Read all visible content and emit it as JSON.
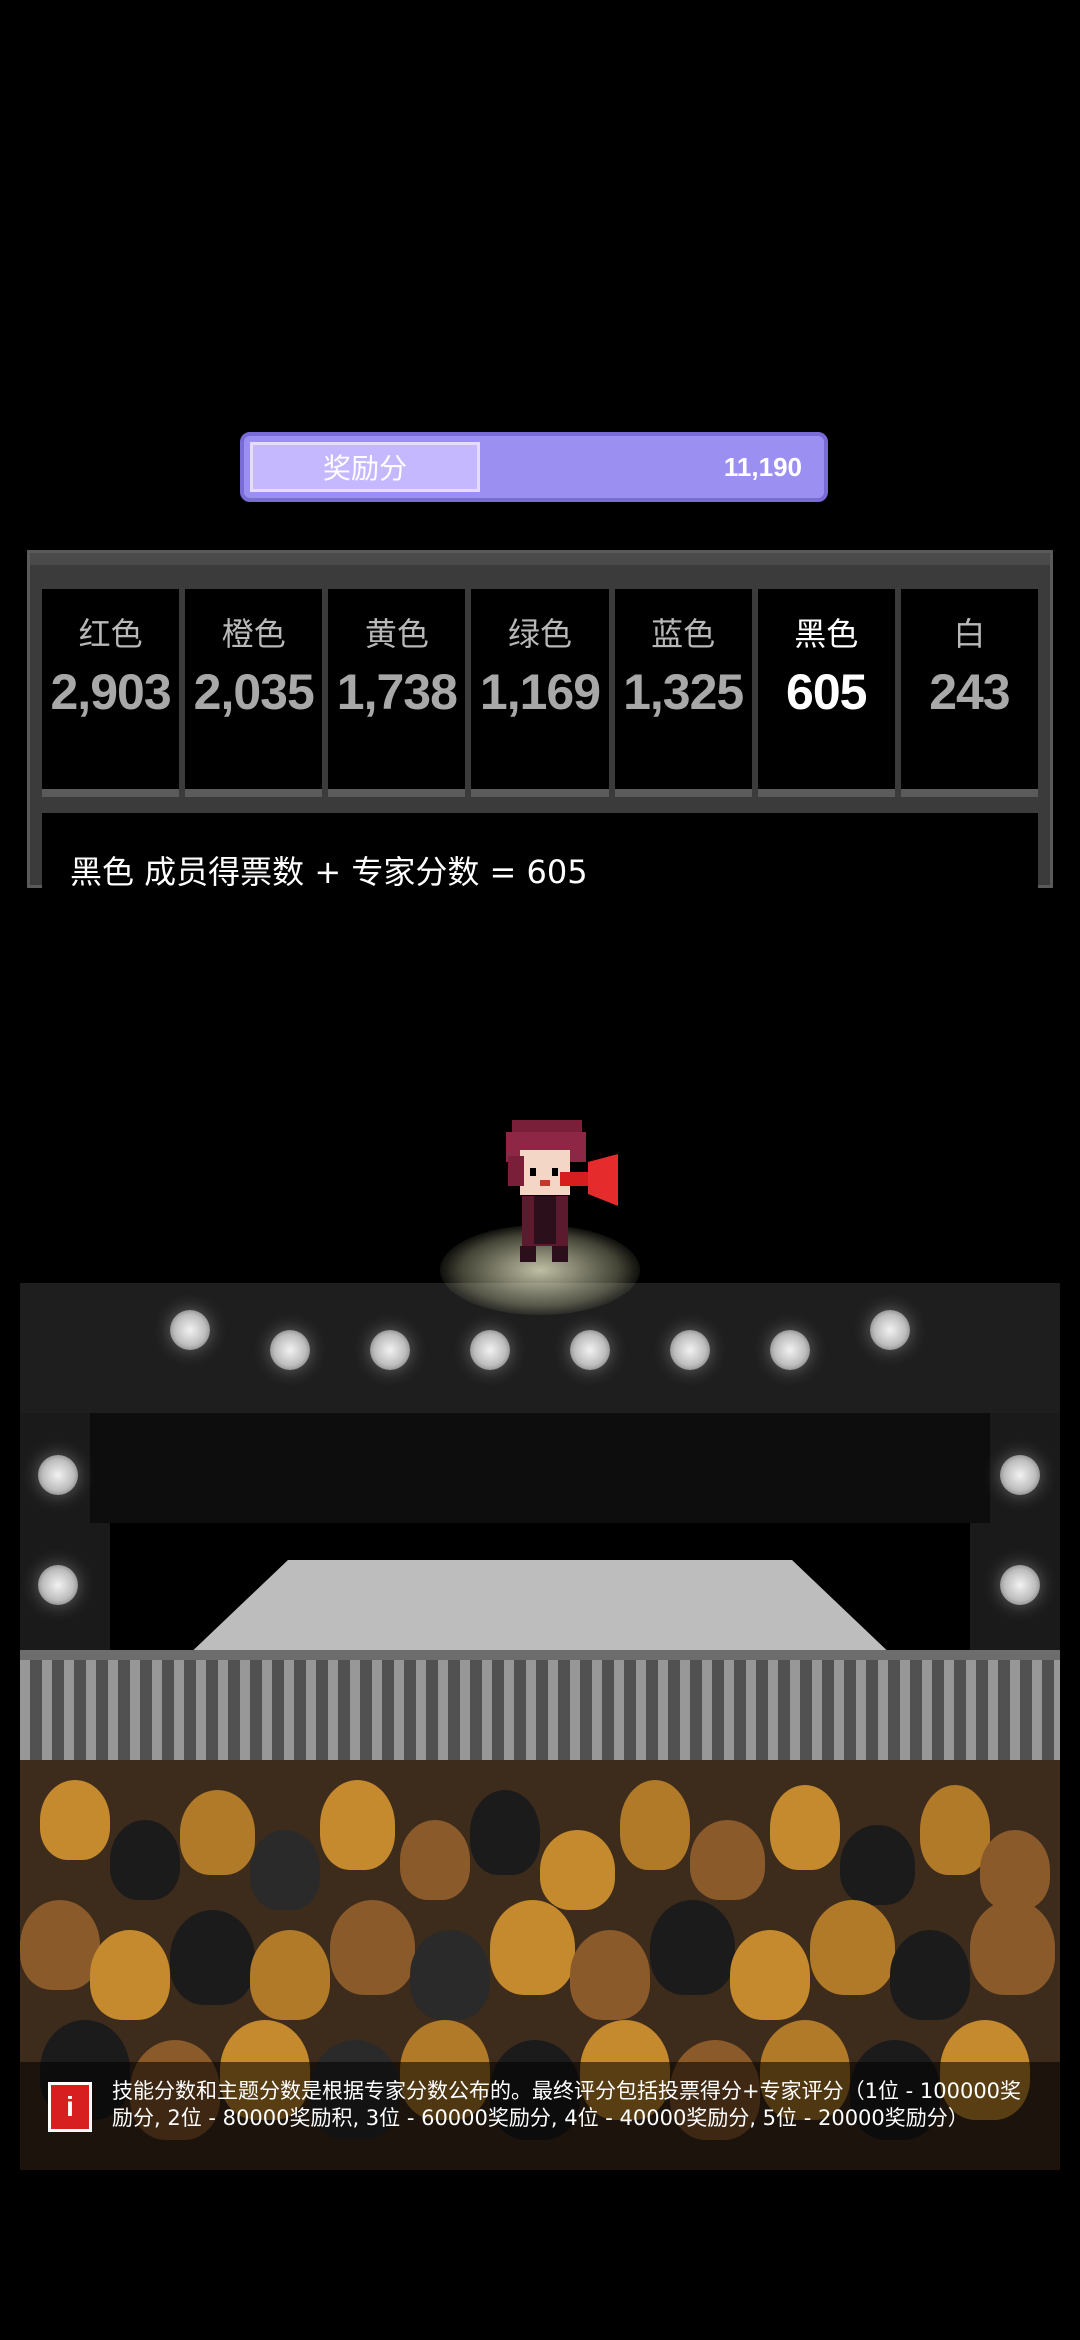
{
  "bonus": {
    "label": "奖励分",
    "value": "11,190"
  },
  "scores": {
    "columns": [
      {
        "name": "红色",
        "value": "2,903"
      },
      {
        "name": "橙色",
        "value": "2,035"
      },
      {
        "name": "黄色",
        "value": "1,738"
      },
      {
        "name": "绿色",
        "value": "1,169"
      },
      {
        "name": "蓝色",
        "value": "1,325"
      },
      {
        "name": "黑色",
        "value": "605"
      },
      {
        "name": "白",
        "value": "243"
      }
    ],
    "selected": "黑色",
    "formula": "黑色 成员得票数 + 专家分数 = 605"
  },
  "note": {
    "icon": "info-icon",
    "text": "技能分数和主题分数是根据专家分数公布的。最终评分包括投票得分+专家评分（1位 - 100000奖励分, 2位 - 80000奖励积, 3位 - 60000奖励分, 4位 - 40000奖励分, 5位 - 20000奖励分）"
  },
  "colors": {
    "bonus_bar": "#9c8ff2",
    "bonus_label_bg": "#c6b8ff",
    "panel_bg": "#3b3b3b",
    "info_icon": "#d71f1f"
  }
}
